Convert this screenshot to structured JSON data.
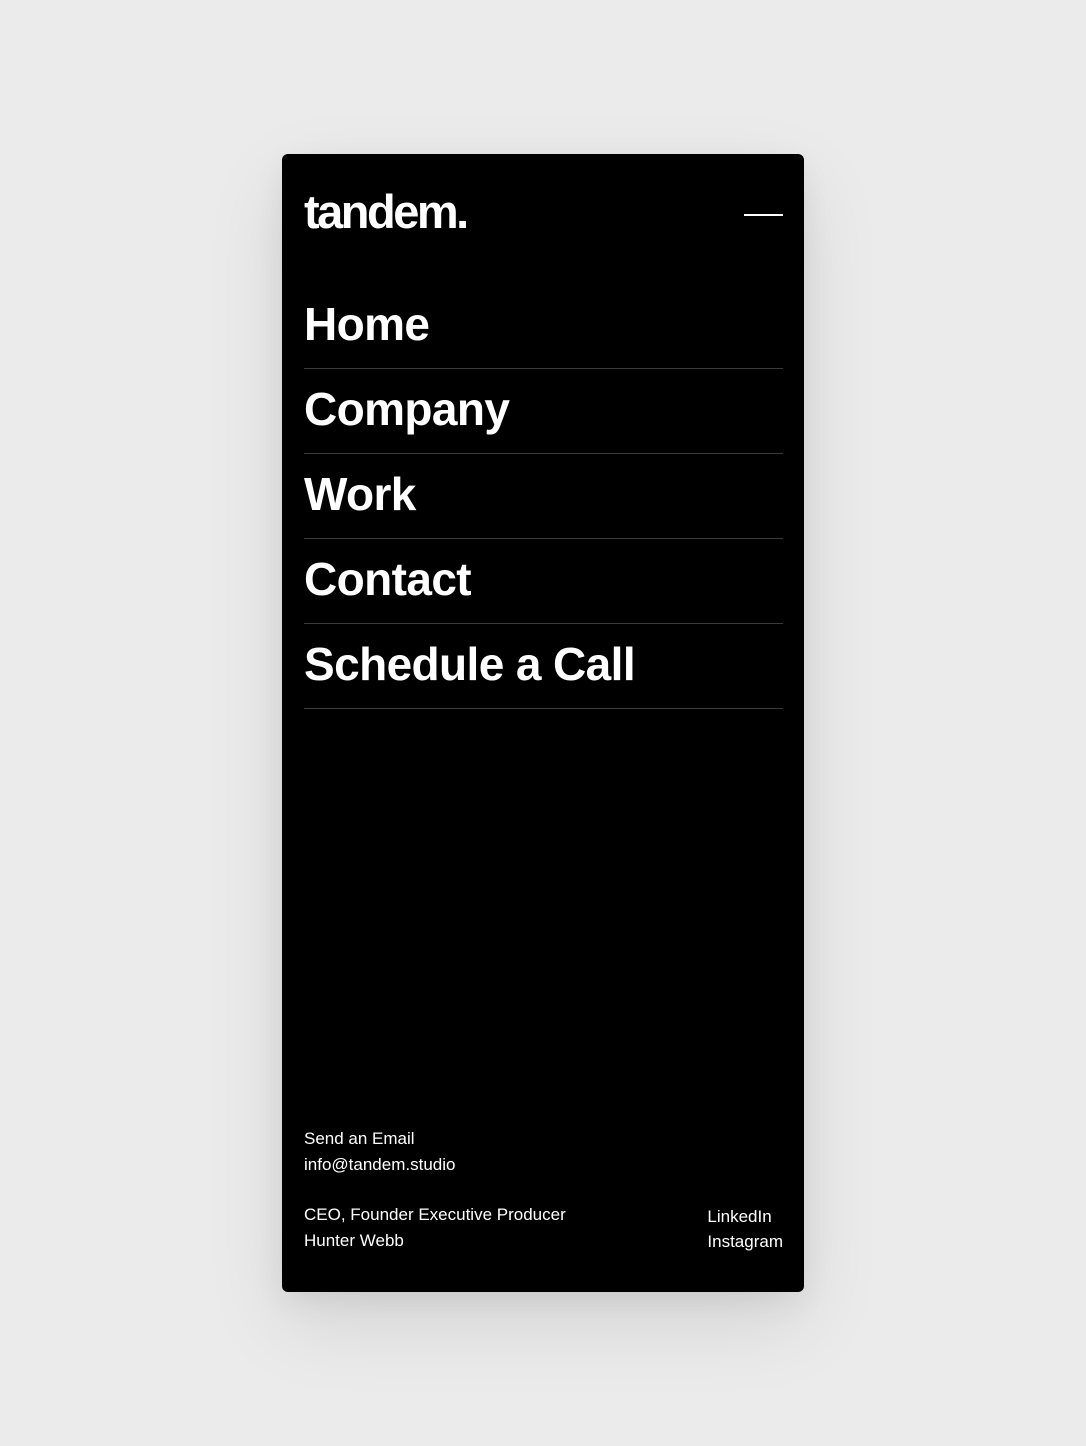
{
  "brand": {
    "logo_text": "tandem."
  },
  "header": {
    "menu_icon": "menu-close-icon"
  },
  "nav": {
    "items": [
      {
        "label": "Home"
      },
      {
        "label": "Company"
      },
      {
        "label": "Work"
      },
      {
        "label": "Contact"
      },
      {
        "label": "Schedule a Call"
      }
    ]
  },
  "footer": {
    "email_heading": "Send an Email",
    "email_address": "info@tandem.studio",
    "credit_role": "CEO, Founder Executive Producer",
    "credit_name": "Hunter Webb",
    "social": [
      {
        "label": "LinkedIn"
      },
      {
        "label": "Instagram"
      }
    ]
  },
  "colors": {
    "page_background": "#ebebeb",
    "panel_background": "#000000",
    "text": "#ffffff",
    "divider": "#3a3a3a"
  }
}
